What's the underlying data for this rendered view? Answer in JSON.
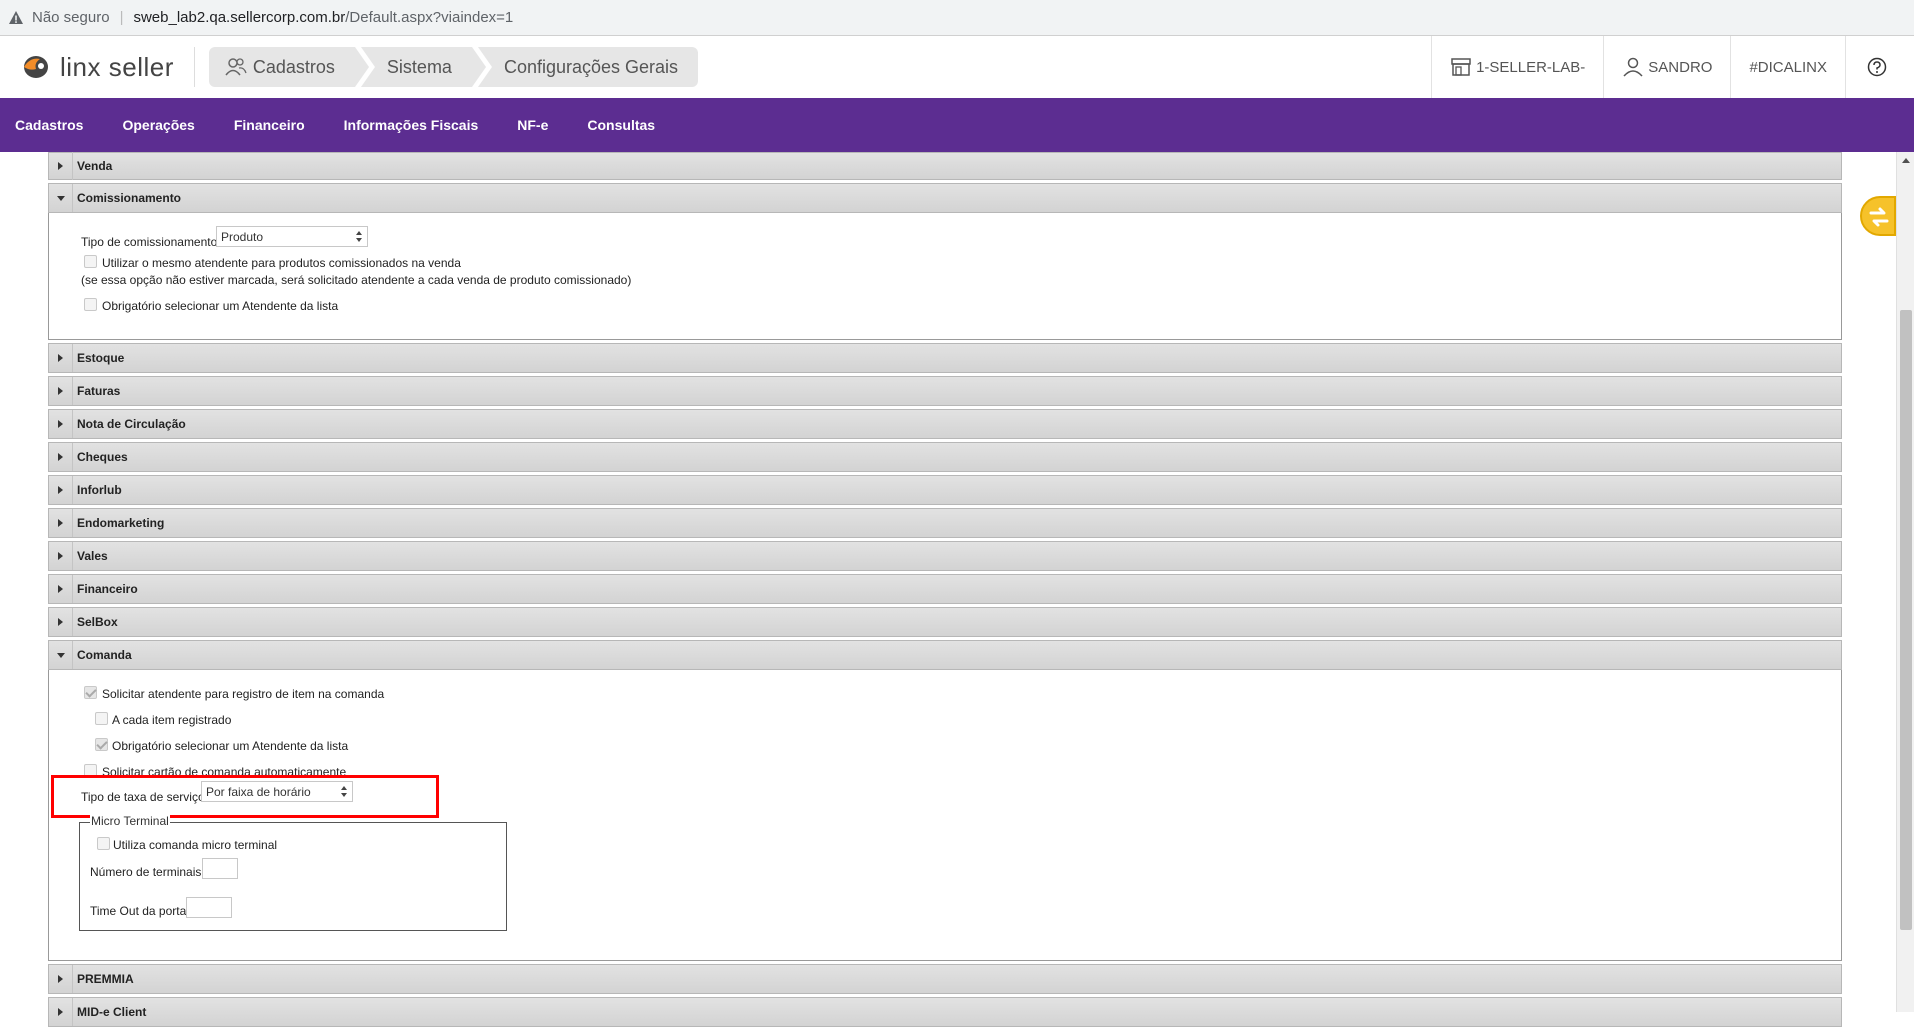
{
  "browser": {
    "security_label": "Não seguro",
    "url_host": "sweb_lab2.qa.sellercorp.com.br",
    "url_path": "/Default.aspx?viaindex=1"
  },
  "header": {
    "logo_text": "linx seller",
    "breadcrumbs": [
      {
        "label": "Cadastros",
        "icon": "users-icon"
      },
      {
        "label": "Sistema"
      },
      {
        "label": "Configurações Gerais"
      }
    ],
    "store_label": "1-SELLER-LAB-",
    "user_label": "SANDRO",
    "tag_label": "#DICALINX",
    "help_icon": "help-circle-icon"
  },
  "menu": {
    "items": [
      "Cadastros",
      "Operações",
      "Financeiro",
      "Informações Fiscais",
      "NF-e",
      "Consultas"
    ]
  },
  "sections": {
    "venda": "Venda",
    "comissionamento": {
      "title": "Comissionamento",
      "tipo_label": "Tipo de comissionamento",
      "tipo_value": "Produto",
      "mesmo_atendente_label": "Utilizar o mesmo atendente para produtos comissionados na venda",
      "nota": "(se essa opção não estiver marcada, será solicitado atendente a cada venda de produto comissionado)",
      "obrigatorio_label": "Obrigatório selecionar um Atendente da lista",
      "mesmo_atendente_checked": false,
      "obrigatorio_checked": false
    },
    "collapsed_a": [
      "Estoque",
      "Faturas",
      "Nota de Circulação",
      "Cheques",
      "Inforlub",
      "Endomarketing",
      "Vales",
      "Financeiro",
      "SelBox"
    ],
    "comanda": {
      "title": "Comanda",
      "solicitar_atendente_label": "Solicitar atendente para registro de item na comanda",
      "solicitar_atendente_checked": true,
      "a_cada_item_label": "A cada item registrado",
      "a_cada_item_checked": false,
      "obrigatorio_label": "Obrigatório selecionar um Atendente da lista",
      "obrigatorio_checked": true,
      "cartao_label": "Solicitar cartão de comanda automaticamente",
      "cartao_checked": false,
      "taxa_label": "Tipo de taxa de serviço",
      "taxa_value": "Por faixa de horário",
      "micro_terminal": {
        "legend": "Micro Terminal",
        "utiliza_label": "Utiliza comanda micro terminal",
        "utiliza_checked": false,
        "numero_label": "Número de terminais",
        "numero_value": "",
        "timeout_label": "Time Out da porta",
        "timeout_value": ""
      }
    },
    "collapsed_b": [
      "PREMMIA",
      "MID-e Client"
    ]
  },
  "colors": {
    "menu_bg": "#5c2d91",
    "highlight": "#ff0000",
    "helper": "#f6c22a"
  }
}
